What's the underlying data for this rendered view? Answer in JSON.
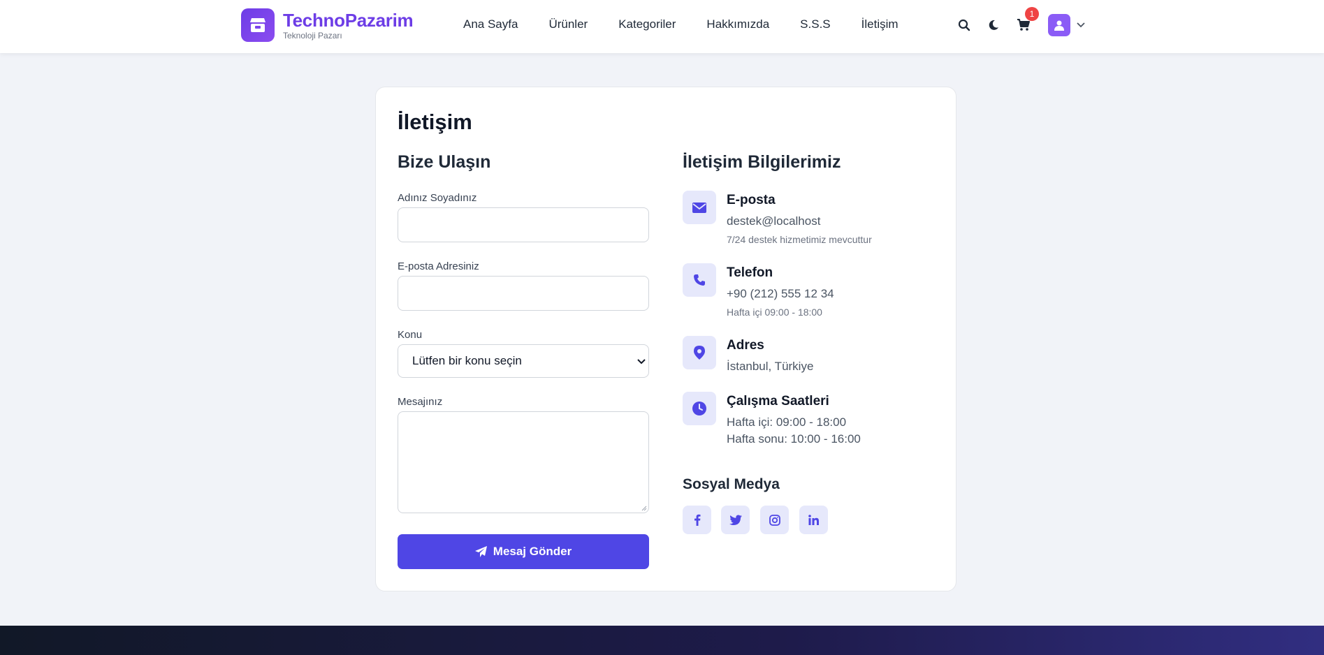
{
  "brand": {
    "name": "TechnoPazarim",
    "tagline": "Teknoloji Pazarı"
  },
  "nav": [
    "Ana Sayfa",
    "Ürünler",
    "Kategoriler",
    "Hakkımızda",
    "S.S.S",
    "İletişim"
  ],
  "header": {
    "cart_count": "1"
  },
  "page": {
    "title": "İletişim"
  },
  "form": {
    "title": "Bize Ulaşın",
    "name_label": "Adınız Soyadınız",
    "name_value": "",
    "email_label": "E-posta Adresiniz",
    "email_value": "",
    "subject_label": "Konu",
    "subject_selected": "Lütfen bir konu seçin",
    "message_label": "Mesajınız",
    "message_value": "",
    "submit_label": "Mesaj Gönder"
  },
  "info": {
    "title": "İletişim Bilgilerimiz",
    "email": {
      "title": "E-posta",
      "value": "destek@localhost",
      "note": "7/24 destek hizmetimiz mevcuttur",
      "icon": "envelope-icon"
    },
    "phone": {
      "title": "Telefon",
      "value": "+90 (212) 555 12 34",
      "note": "Hafta içi 09:00 - 18:00",
      "icon": "phone-icon"
    },
    "address": {
      "title": "Adres",
      "value": "İstanbul, Türkiye",
      "icon": "map-pin-icon"
    },
    "hours": {
      "title": "Çalışma Saatleri",
      "weekday": "Hafta içi: 09:00 - 18:00",
      "weekend": "Hafta sonu: 10:00 - 16:00",
      "icon": "clock-icon"
    }
  },
  "social": {
    "title": "Sosyal Medya",
    "items": [
      "facebook-icon",
      "twitter-icon",
      "instagram-icon",
      "linkedin-icon"
    ]
  },
  "colors": {
    "primary": "#4f46e5",
    "brand": "#6d3de6",
    "badge": "#ef4444",
    "icon_bg": "#e6e8fb"
  }
}
